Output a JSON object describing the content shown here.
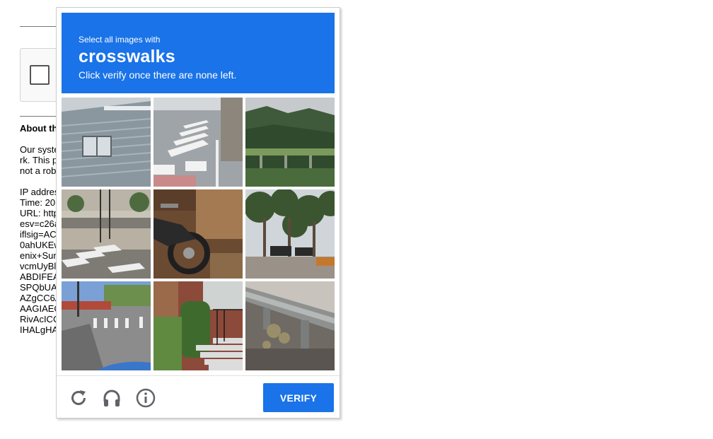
{
  "background_page": {
    "heading": "About th",
    "paragraph_lines": [
      "Our syste",
      "rk. This p",
      "not a rob"
    ],
    "info_lines": [
      "IP addres",
      "Time: 20",
      "URL: http",
      "esv=c26a",
      "iflsig=AC",
      "0ahUKEw",
      "enix+Sun",
      "vcmUyBl",
      "ABDIFEA",
      "SPQbUA",
      "AZgCC6A",
      "AAGIAEC",
      "RivAcICC",
      "IHALgHA"
    ]
  },
  "challenge": {
    "instruction_small": "Select all images with",
    "target": "crosswalks",
    "instruction_sub": "Click verify once there are none left.",
    "tiles": [
      {
        "name": "tile-building-facade"
      },
      {
        "name": "tile-road-crosswalk"
      },
      {
        "name": "tile-mountain-bridge"
      },
      {
        "name": "tile-street-crosswalk"
      },
      {
        "name": "tile-motorcycle"
      },
      {
        "name": "tile-trees-parking"
      },
      {
        "name": "tile-intersection-crosswalk"
      },
      {
        "name": "tile-hedge-stairs"
      },
      {
        "name": "tile-guardrail"
      }
    ],
    "verify_label": "VERIFY",
    "icons": [
      "reload-icon",
      "headphones-icon",
      "info-icon"
    ]
  },
  "colors": {
    "accent": "#1a73e8",
    "icon_gray": "#5f6368"
  }
}
